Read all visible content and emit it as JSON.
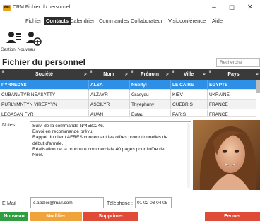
{
  "window": {
    "title": "CRM Fichier du personnel",
    "app_badge": "WD",
    "minimize": "–",
    "maximize": "☐",
    "close": "✕"
  },
  "menu": {
    "items": [
      "Fichier",
      "Contacts",
      "Calendrier",
      "Commandes",
      "Collaborateur",
      "Visioconférence",
      "Aide"
    ],
    "active": "Contacts"
  },
  "toolbar": {
    "gestion_label": "Gestion",
    "nouveau_label": "Nouveau"
  },
  "page": {
    "title": "Fichier du personnel",
    "search_placeholder": "Recherche"
  },
  "table": {
    "columns": [
      "Société",
      "Nom",
      "Prénom",
      "Ville",
      "Pays"
    ],
    "rows": [
      [
        "PYRNEDYS",
        "ALSA",
        "Nueifyl",
        "LE CAIRE",
        "EGYPTE"
      ],
      [
        "CUBANVTYR NEASYTTY",
        "ALZAYR",
        "Grasydu",
        "KIEV",
        "UKRAINE"
      ],
      [
        "PURLYMNTYN YIREPYYN",
        "ASCILYR",
        "Thyephuny",
        "CUEBRIS",
        "FRANCE"
      ],
      [
        "LEGASAN FYR",
        "AUAN",
        "Eutau",
        "PARIS",
        "FRANCE"
      ]
    ],
    "selected_row": 0
  },
  "notes": {
    "label": "Notes :",
    "lines": [
      "Suivi de la commande N°4580246.",
      "Envoi en recommandé prévu.",
      "Rappel du client AFRES concernant les offres promotionnelles de",
      "début d'année.",
      "Réalisation de la brochure commerciale 40 pages pour l'offre de",
      "Noël."
    ]
  },
  "contact": {
    "email_label": "E-Mail :",
    "email_value": "c.abdier@mail.com",
    "phone_label": "Téléphone :",
    "phone_value": "01 02 03 04 05"
  },
  "buttons": {
    "nouveau": "Nouveau",
    "modifier": "Modifier",
    "supprimer": "Supprimer",
    "fermer": "Fermer"
  },
  "colors": {
    "header_bg": "#3a3a3a",
    "selected_row": "#2e8fe6",
    "btn_nouveau": "#2e9e3e",
    "btn_modifier": "#f0a33a",
    "btn_supprimer": "#e04b38",
    "btn_fermer": "#e04b38"
  },
  "icons": {
    "gestion": "user-list-icon",
    "nouveau": "user-add-icon",
    "sort": "sort-arrows-icon",
    "search": "magnifier-icon"
  }
}
